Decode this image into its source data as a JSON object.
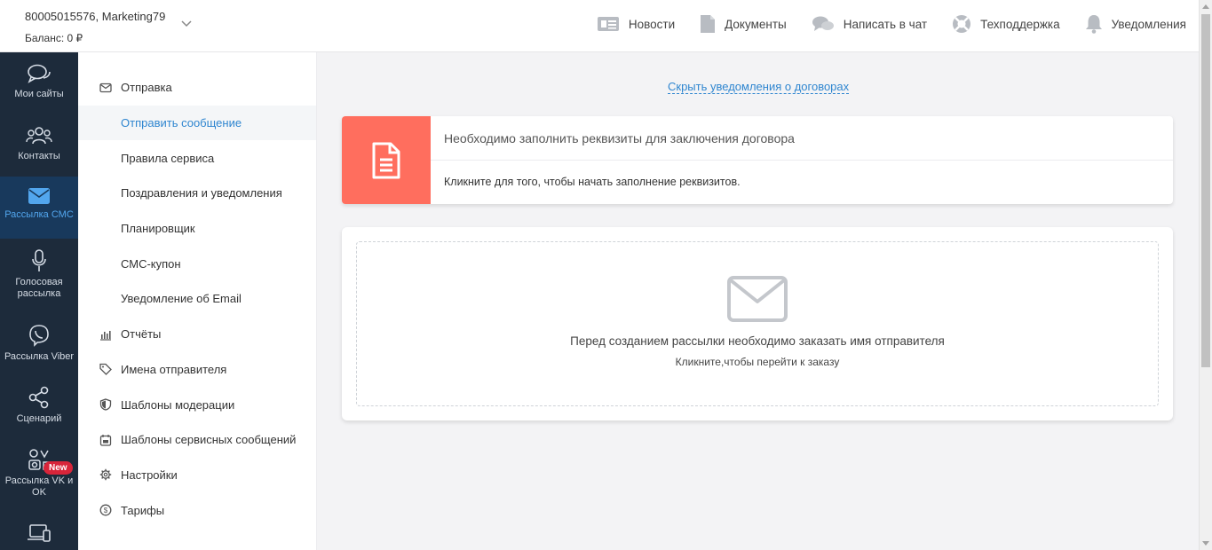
{
  "account": {
    "id": "80005015576",
    "separator": ", ",
    "name": "Marketing79",
    "balance": "Баланс: 0 ₽"
  },
  "topnav": [
    {
      "label": "Новости",
      "icon": "newspaper-icon"
    },
    {
      "label": "Документы",
      "icon": "document-icon"
    },
    {
      "label": "Написать в чат",
      "icon": "chat-icon"
    },
    {
      "label": "Техподдержка",
      "icon": "lifebuoy-icon"
    },
    {
      "label": "Уведомления",
      "icon": "bell-icon"
    }
  ],
  "rail": [
    {
      "label": "Мои сайты",
      "icon": "chat-bubbles-icon"
    },
    {
      "label": "Контакты",
      "icon": "people-icon"
    },
    {
      "label": "Рассылка СМС",
      "icon": "envelope-icon",
      "active": true
    },
    {
      "label": "Голосовая рассылка",
      "icon": "microphone-icon"
    },
    {
      "label": "Рассылка Viber",
      "icon": "viber-icon"
    },
    {
      "label": "Сценарий",
      "icon": "share-icon"
    },
    {
      "label": "Рассылка VK и OK",
      "icon": "social-icon"
    },
    {
      "label": "",
      "icon": "devices-icon",
      "badge": "New"
    }
  ],
  "subnav": [
    {
      "label": "Отправка",
      "icon": "envelope-icon"
    },
    {
      "label": "Отправить сообщение",
      "child": true,
      "selected": true
    },
    {
      "label": "Правила сервиса",
      "child": true
    },
    {
      "label": "Поздравления и уведомления",
      "child": true
    },
    {
      "label": "Планировщик",
      "child": true
    },
    {
      "label": "СМС-купон",
      "child": true
    },
    {
      "label": "Уведомление об Email",
      "child": true
    },
    {
      "label": "Отчёты",
      "icon": "bar-chart-icon"
    },
    {
      "label": "Имена отправителя",
      "icon": "tag-icon"
    },
    {
      "label": "Шаблоны модерации",
      "icon": "shield-icon"
    },
    {
      "label": "Шаблоны сервисных сообщений",
      "icon": "calendar-icon"
    },
    {
      "label": "Настройки",
      "icon": "gear-icon"
    },
    {
      "label": "Тарифы",
      "icon": "dollar-icon"
    }
  ],
  "main": {
    "hide_link": "Скрыть уведомления о договорах",
    "contract": {
      "title": "Необходимо заполнить реквизиты для заключения договора",
      "subtitle": "Кликните для того, чтобы начать заполнение реквизитов."
    },
    "sender": {
      "text": "Перед созданием рассылки необходимо заказать имя отправителя",
      "subtext": "Кликните,чтобы перейти к заказу"
    }
  },
  "colors": {
    "rail_bg": "#1d2b3b",
    "rail_active": "#52a6ee",
    "accent": "#2f86d0",
    "alert": "#ff6e5e",
    "badge": "#d8253a"
  }
}
